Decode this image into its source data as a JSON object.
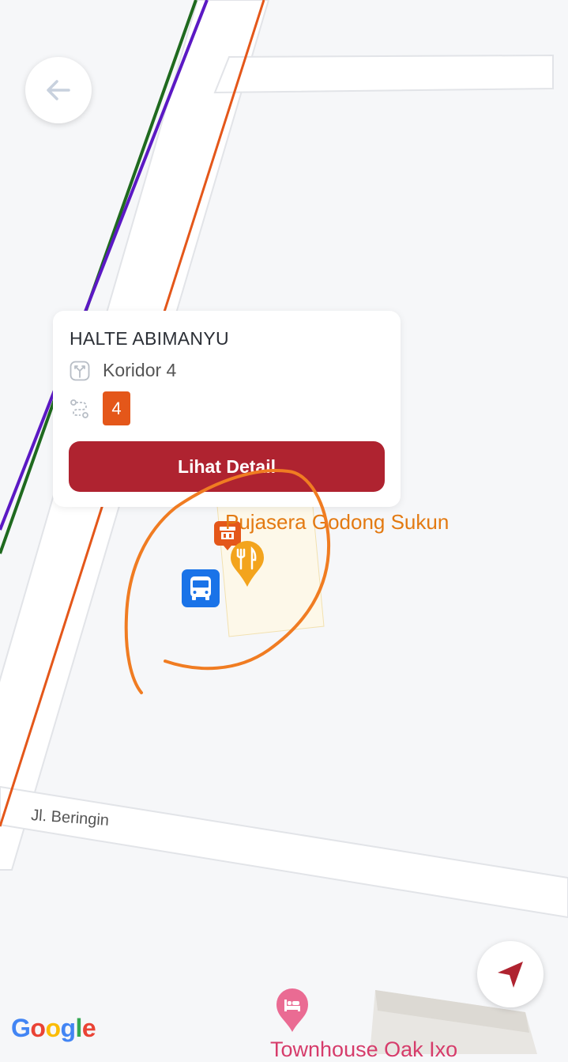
{
  "map": {
    "street_label": "Jl. Beringin",
    "poi_label": "Pujasera Godong Sukun",
    "bottom_poi_label": "Townhouse Oak Ixo"
  },
  "stop_card": {
    "name": "HALTE ABIMANYU",
    "corridor": "Koridor 4",
    "route_badge": "4",
    "detail_button": "Lihat Detail"
  },
  "google_logo": {
    "letters": [
      "G",
      "o",
      "o",
      "g",
      "l",
      "e"
    ],
    "colors": [
      "#4285F4",
      "#EA4335",
      "#FBBC05",
      "#4285F4",
      "#34A853",
      "#EA4335"
    ]
  },
  "colors": {
    "accent": "#af2330",
    "badge": "#e4571a",
    "route_orange": "#e4571a",
    "route_purple": "#5b19c4",
    "route_green": "#1f6a1f",
    "bus_stop_blue": "#1a73e8",
    "annotation_orange": "#f07c22"
  },
  "icons": {
    "back": "arrow-left-icon",
    "locate": "navigation-arrow-icon",
    "corridor": "branch-icon",
    "route": "route-icon",
    "bus_stop": "bus-icon",
    "restaurant": "restaurant-icon",
    "food_stall": "food-stall-icon",
    "hotel": "hotel-icon"
  }
}
